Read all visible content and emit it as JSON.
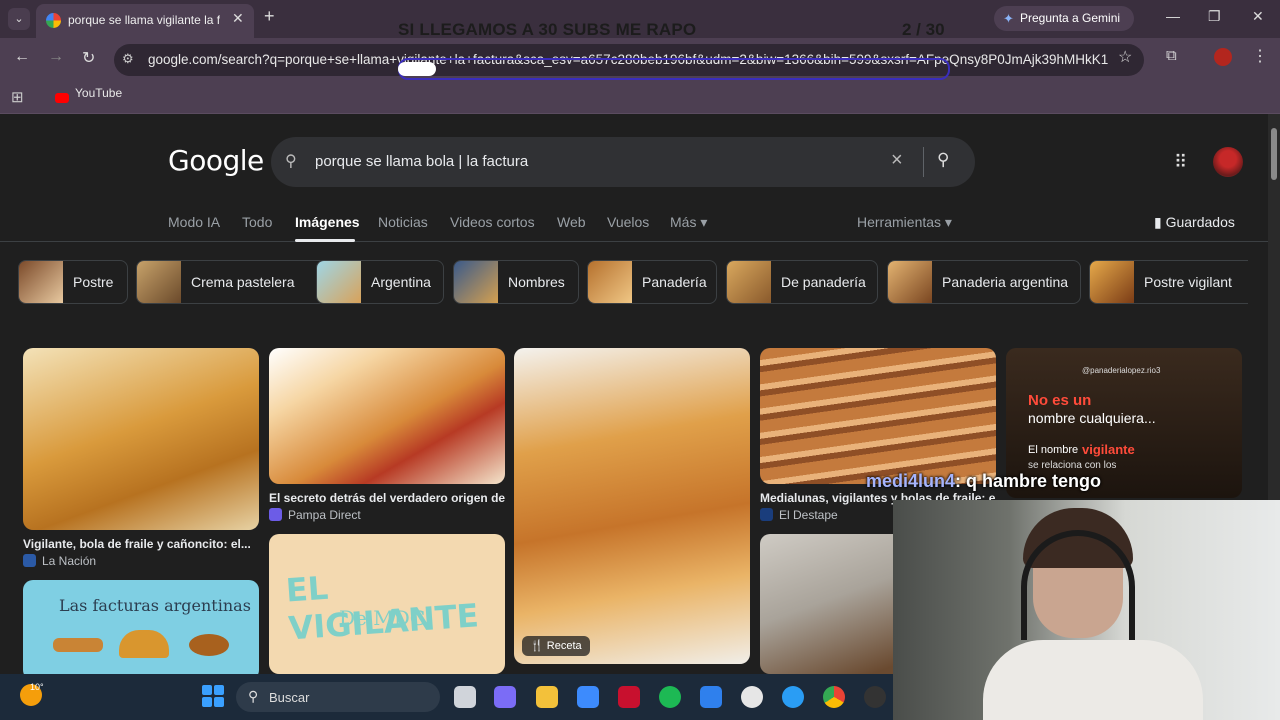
{
  "browser": {
    "tab_title": "porque se llama vigilante la fac",
    "tab_close": "✕",
    "new_tab": "+",
    "gemini_label": "Pregunta a Gemini",
    "url": "google.com/search?q=porque+se+llama+vigilante+la+factura&sca_esv=a657c280beb196bf&udm=2&biw=1366&bih=599&sxsrf=AFpeQnsy8P0JmAjk39hMHkK1-...",
    "bookmark_youtube": "YouTube"
  },
  "stream_overlay": {
    "title": "SI LLEGAMOS A 30 SUBS ME RAPO",
    "count": "2 / 30",
    "chat_user": "medi4lun4",
    "chat_text": ": q hambre tengo"
  },
  "google": {
    "logo": "Google",
    "query": "porque se llama bola | la factura",
    "tabs": [
      "Modo IA",
      "Todo",
      "Imágenes",
      "Noticias",
      "Videos cortos",
      "Web",
      "Vuelos",
      "Más ▾"
    ],
    "tools": "Herramientas ▾",
    "saved": "Guardados",
    "chips": [
      "Postre",
      "Crema pastelera",
      "Argentina",
      "Nombres",
      "Panadería",
      "De panadería",
      "Panaderia argentina",
      "Postre vigilant"
    ],
    "results": [
      {
        "title": "Vigilante, bola de fraile y cañoncito: el...",
        "source": "La Nación"
      },
      {
        "title": "El secreto detrás del verdadero origen de...",
        "source": "Pampa Direct"
      },
      {
        "title": "Medialunas, vigilantes y bolas de fraile: el...",
        "source": "El Destape"
      }
    ],
    "recipe_badge": "Receta",
    "tile_text_1": "Las facturas argentinas",
    "tile_text_2": "EL VIGILANTE",
    "tile_text_3": "De MDG",
    "tile_text_4a": "No es un",
    "tile_text_4b": "nombre cualquiera...",
    "tile_text_4c": "El nombre",
    "tile_text_4d": "vigilante",
    "tile_text_4e": "se relaciona con los",
    "tile_text_4f": "@panaderialopez.rio3"
  },
  "taskbar": {
    "weather_temp": "10°",
    "search_label": "Buscar"
  },
  "colors": {
    "tabbar": "#3a2f3e",
    "toolbar": "#4d3f52",
    "page_bg": "#1f1f1f",
    "search_box": "#303134",
    "taskbar": "#1c2a3a"
  }
}
